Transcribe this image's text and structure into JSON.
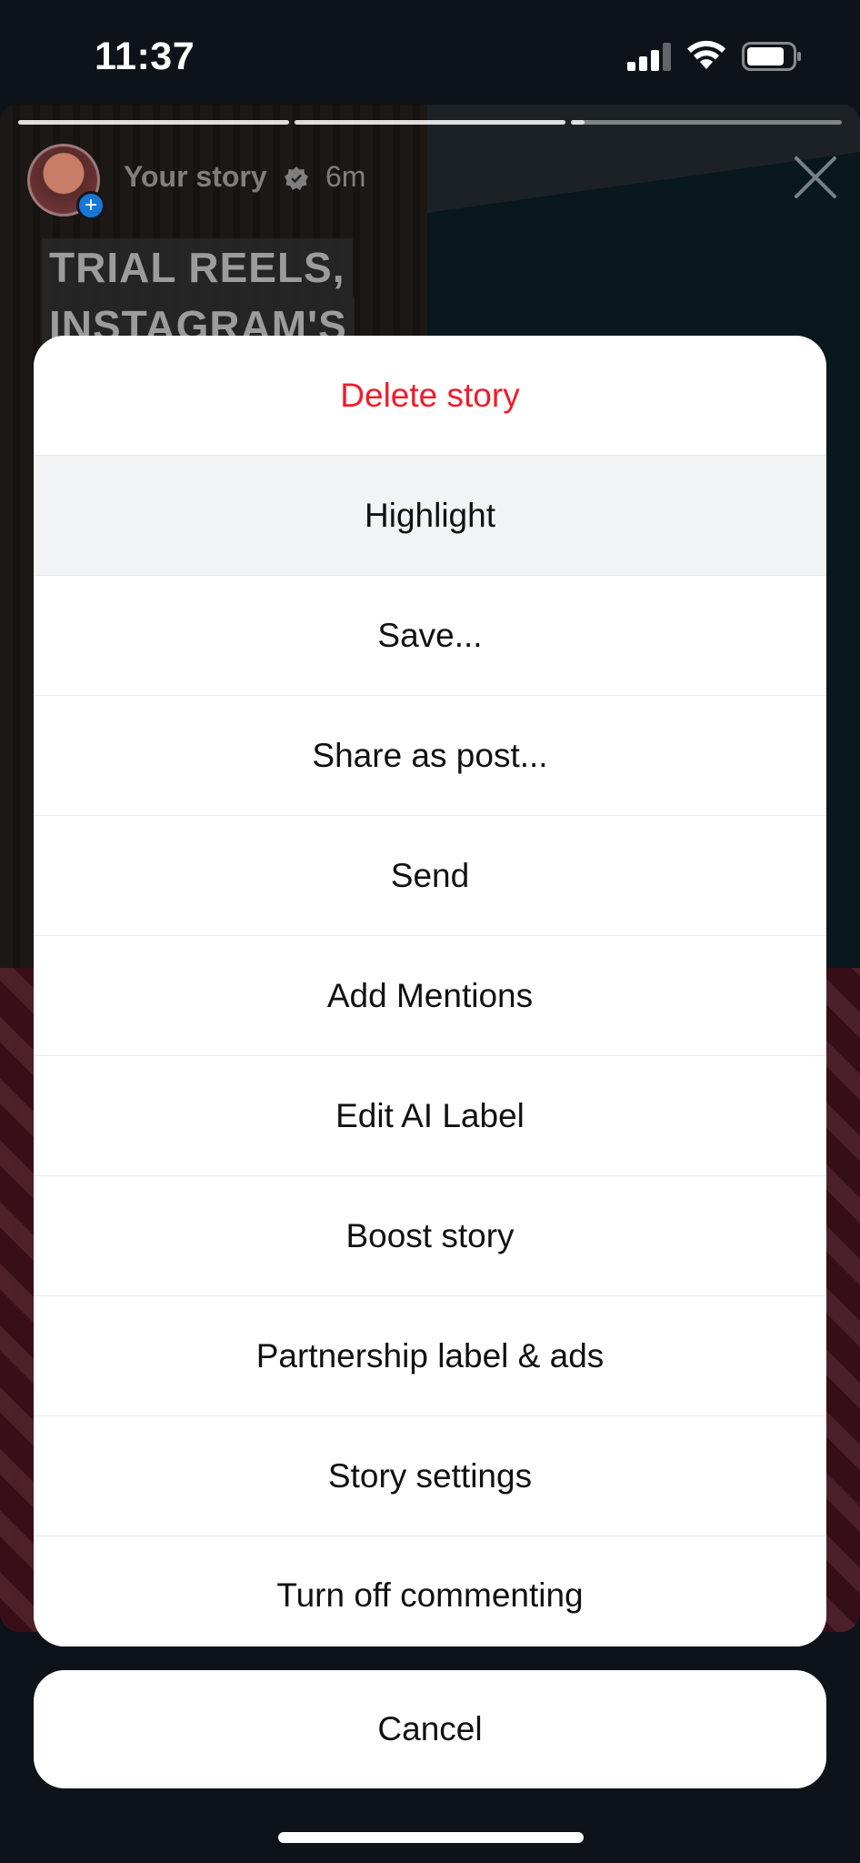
{
  "status_bar": {
    "time": "11:37"
  },
  "story": {
    "username": "Your story",
    "time_ago": "6m",
    "headline_lines": [
      "TRIAL REELS,",
      "INSTAGRAM'S"
    ],
    "progress_segments": [
      {
        "fill": 1.0
      },
      {
        "fill": 1.0
      },
      {
        "fill": 0.05
      }
    ]
  },
  "action_sheet": {
    "items": [
      {
        "label": "Delete story",
        "style": "destructive"
      },
      {
        "label": "Highlight",
        "style": "pressed"
      },
      {
        "label": "Save..."
      },
      {
        "label": "Share as post..."
      },
      {
        "label": "Send"
      },
      {
        "label": "Add Mentions"
      },
      {
        "label": "Edit AI Label"
      },
      {
        "label": "Boost story"
      },
      {
        "label": "Partnership label & ads"
      },
      {
        "label": "Story settings"
      },
      {
        "label": "Turn off commenting"
      }
    ],
    "cancel_label": "Cancel"
  },
  "colors": {
    "destructive": "#ee1d2b",
    "sheet_background": "#ffffff",
    "pressed_background": "#f2f3f5",
    "backdrop": "#0e1319"
  },
  "icons": {
    "status": [
      "cellular-signal-icon",
      "wifi-icon",
      "battery-icon"
    ],
    "story_header": [
      "avatar",
      "add-story-plus-icon",
      "verified-badge-icon",
      "close-icon"
    ]
  }
}
